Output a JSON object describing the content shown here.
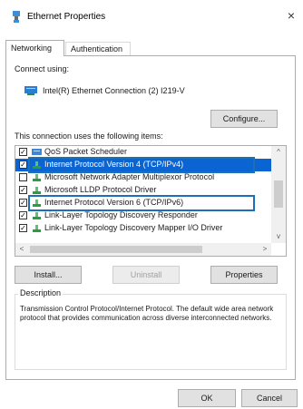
{
  "window": {
    "title": "Ethernet Properties",
    "close": "×"
  },
  "tabs": [
    {
      "label": "Networking",
      "active": true
    },
    {
      "label": "Authentication",
      "active": false
    }
  ],
  "connect_using": {
    "label": "Connect using:",
    "adapter": "Intel(R) Ethernet Connection (2) I219-V",
    "configure_button": "Configure..."
  },
  "items": {
    "label": "This connection uses the following items:",
    "rows": [
      {
        "text": "QoS Packet Scheduler",
        "checked": true,
        "selected": false,
        "icon": "qos-scheduler-icon"
      },
      {
        "text": "Internet Protocol Version 4 (TCP/IPv4)",
        "checked": true,
        "selected": true,
        "icon": "network-protocol-icon"
      },
      {
        "text": "Microsoft Network Adapter Multiplexor Protocol",
        "checked": false,
        "selected": false,
        "icon": "network-protocol-icon"
      },
      {
        "text": "Microsoft LLDP Protocol Driver",
        "checked": true,
        "selected": false,
        "icon": "network-protocol-icon"
      },
      {
        "text": "Internet Protocol Version 6 (TCP/IPv6)",
        "checked": true,
        "selected": false,
        "icon": "network-protocol-icon"
      },
      {
        "text": "Link-Layer Topology Discovery Responder",
        "checked": true,
        "selected": false,
        "icon": "network-protocol-icon"
      },
      {
        "text": "Link-Layer Topology Discovery Mapper I/O Driver",
        "checked": true,
        "selected": false,
        "icon": "network-protocol-icon"
      }
    ],
    "scroll_left": "<",
    "scroll_right": ">",
    "scroll_up": "^",
    "scroll_down": "v"
  },
  "buttons": {
    "install": "Install...",
    "uninstall": "Uninstall",
    "properties": "Properties"
  },
  "description": {
    "label": "Description",
    "text": "Transmission Control Protocol/Internet Protocol. The default wide area network protocol that provides communication across diverse interconnected networks."
  },
  "footer": {
    "ok": "OK",
    "cancel": "Cancel"
  },
  "colors": {
    "selection": "#0a64d1",
    "highlight_border": "#1f6fb5"
  }
}
